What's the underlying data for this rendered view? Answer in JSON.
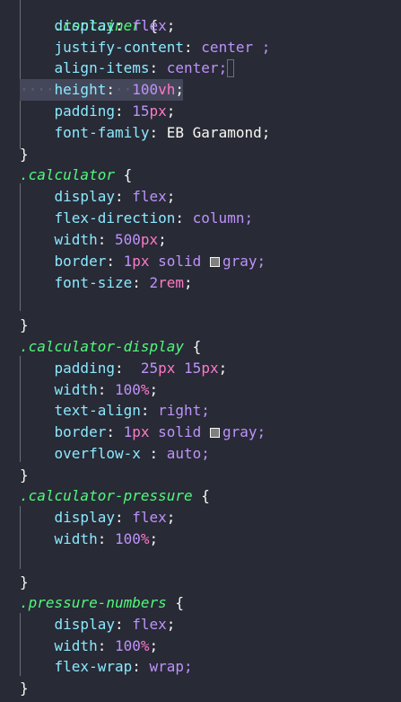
{
  "editor": {
    "language": "css",
    "colors": {
      "background": "#282a36",
      "selector": "#50fa7b",
      "property": "#8be9fd",
      "value": "#bd93f9",
      "unit": "#ff79c6",
      "swatch_gray": "#808080"
    },
    "lines": [
      {
        "selector": ".container",
        "brace": "{"
      },
      {
        "prop": "display",
        "value": "flex"
      },
      {
        "prop": "justify-content",
        "value": "center ;"
      },
      {
        "prop": "align-items",
        "value": "center;"
      },
      {
        "prop": "height",
        "value_num": "100",
        "value_unit": "vh",
        "end": ";"
      },
      {
        "prop": "padding",
        "value_num": "15",
        "value_unit": "px",
        "end": ";"
      },
      {
        "prop": "font-family",
        "value": "EB Garamond;"
      },
      {
        "brace": "}"
      },
      {
        "selector": ".calculator",
        "brace": "{"
      },
      {
        "prop": "display",
        "value": "flex"
      },
      {
        "prop": "flex-direction",
        "value": "column;"
      },
      {
        "prop": "width",
        "value_num": "500",
        "value_unit": "px",
        "end": ";"
      },
      {
        "prop": "border",
        "value_num": "1",
        "value_unit": "px",
        "value_rest": "solid",
        "color_name": "gray;"
      },
      {
        "prop": "font-size",
        "value_num": "2",
        "value_unit": "rem",
        "end": ";"
      },
      {
        "blank": ""
      },
      {
        "brace": "}"
      },
      {
        "selector": ".calculator-display",
        "brace": "{"
      },
      {
        "prop": "padding",
        "value_a": "25",
        "unit_a": "px",
        "value_b": "15",
        "unit_b": "px",
        "end": ";"
      },
      {
        "prop": "width",
        "value_num": "100",
        "value_unit": "%",
        "end": ";"
      },
      {
        "prop": "text-align",
        "value": "right;"
      },
      {
        "prop": "border",
        "value_num": "1",
        "value_unit": "px",
        "value_rest": "solid",
        "color_name": "gray;"
      },
      {
        "prop": "overflow-x",
        "value": "auto;"
      },
      {
        "brace": "}"
      },
      {
        "selector": ".calculator-pressure",
        "brace": "{"
      },
      {
        "prop": "display",
        "value": "flex"
      },
      {
        "prop": "width",
        "value_num": "100",
        "value_unit": "%",
        "end": ";"
      },
      {
        "blank": ""
      },
      {
        "brace": "}"
      },
      {
        "selector": ".pressure-numbers",
        "brace": "{"
      },
      {
        "prop": "display",
        "value": "flex"
      },
      {
        "prop": "width",
        "value_num": "100",
        "value_unit": "%",
        "end": ";"
      },
      {
        "prop": "flex-wrap",
        "value": "wrap;"
      },
      {
        "brace": "}"
      }
    ]
  }
}
